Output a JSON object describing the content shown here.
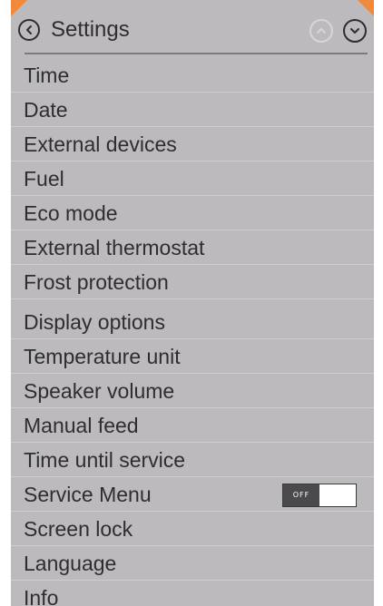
{
  "header": {
    "title": "Settings",
    "back_icon": "chevron-left-circle-icon",
    "up_icon": "chevron-up-circle-icon",
    "down_icon": "chevron-down-circle-icon"
  },
  "colors": {
    "background": "#bcbabd",
    "text": "#2e2d30",
    "accent": "#f08a3a"
  },
  "menu": {
    "items": [
      {
        "label": "Time"
      },
      {
        "label": "Date"
      },
      {
        "label": "External devices"
      },
      {
        "label": "Fuel"
      },
      {
        "label": "Eco mode"
      },
      {
        "label": "External thermostat"
      },
      {
        "label": "Frost protection"
      },
      {
        "label": "Display options"
      },
      {
        "label": "Temperature unit"
      },
      {
        "label": "Speaker volume"
      },
      {
        "label": "Manual feed"
      },
      {
        "label": "Time until service"
      },
      {
        "label": "Service Menu",
        "toggle": "OFF"
      },
      {
        "label": "Screen lock"
      },
      {
        "label": "Language"
      },
      {
        "label": "Info"
      }
    ]
  }
}
